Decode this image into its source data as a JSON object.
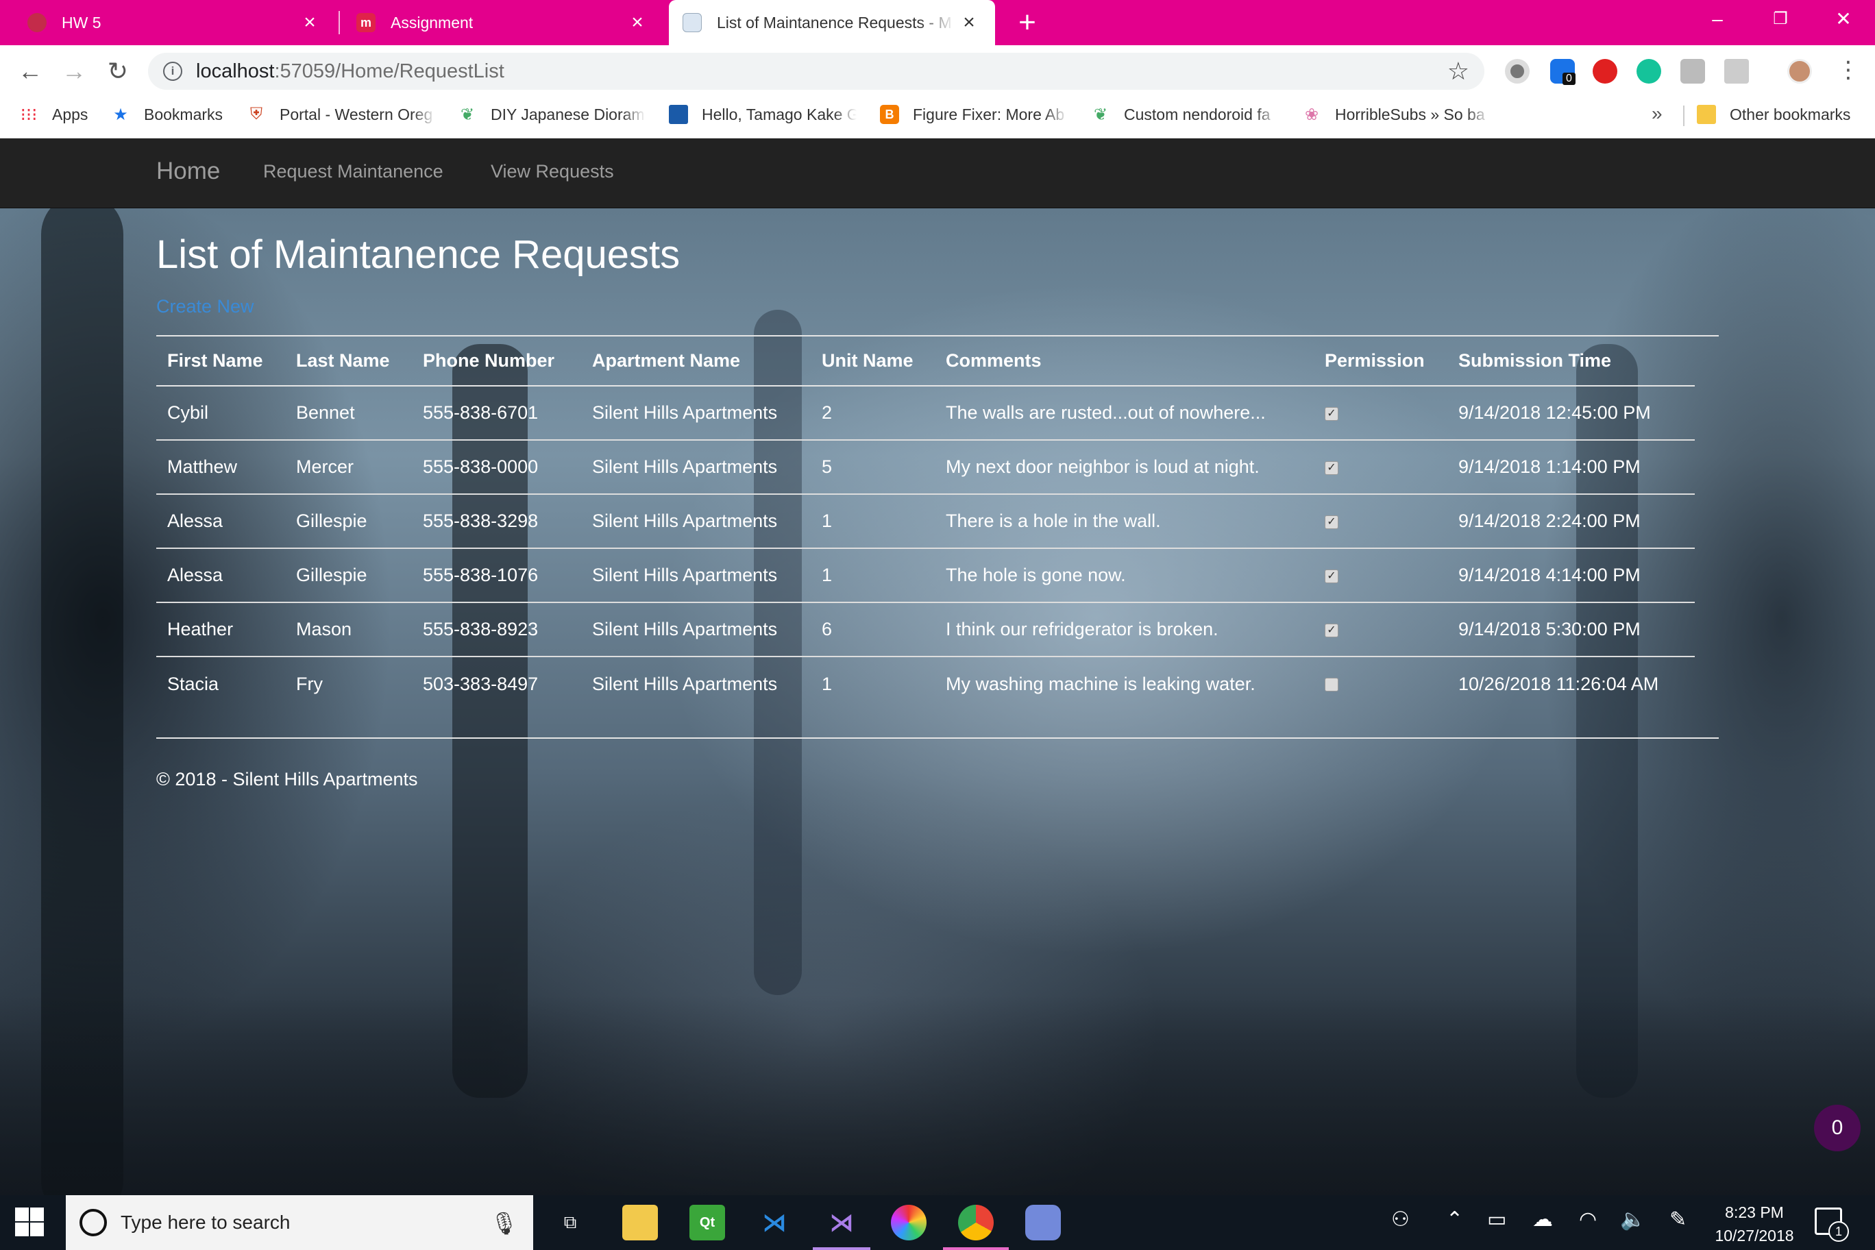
{
  "browser": {
    "tabs": [
      {
        "title": "HW 5",
        "favicon": "red-circle-icon"
      },
      {
        "title": "Assignment",
        "favicon": "m-logo-icon"
      },
      {
        "title": "List of Maintanence Requests - M",
        "favicon": "page-icon",
        "active": true
      }
    ],
    "url_host": "localhost",
    "url_path": ":57059/Home/RequestList",
    "bookmarks": [
      {
        "label": "Apps",
        "icon": "apps-grid-icon"
      },
      {
        "label": "Bookmarks",
        "icon": "star-icon"
      },
      {
        "label": "Portal - Western Oreg",
        "icon": "shield-icon"
      },
      {
        "label": "DIY Japanese Dioram",
        "icon": "leaf-icon"
      },
      {
        "label": "Hello, Tamago Kake G",
        "icon": "folder-icon"
      },
      {
        "label": "Figure Fixer: More Ab",
        "icon": "blogger-icon"
      },
      {
        "label": "Custom nendoroid fa",
        "icon": "leaf-icon"
      },
      {
        "label": "HorribleSubs » So ba",
        "icon": "swirl-icon"
      }
    ],
    "bookmarks_more": "»",
    "other_bookmarks": "Other bookmarks",
    "extension_badge": "0"
  },
  "site": {
    "brand": "Home",
    "nav": [
      "Request Maintanence",
      "View Requests"
    ],
    "page_title": "List of Maintanence Requests",
    "create_new": "Create New",
    "footer": "© 2018 - Silent Hills Apartments",
    "fab_count": "0"
  },
  "table": {
    "headers": [
      "First Name",
      "Last Name",
      "Phone Number",
      "Apartment Name",
      "Unit Name",
      "Comments",
      "Permission",
      "Submission Time"
    ],
    "rows": [
      {
        "first": "Cybil",
        "last": "Bennet",
        "phone": "555-838-6701",
        "apartment": "Silent Hills Apartments",
        "unit": "2",
        "comments": "The walls are rusted...out of nowhere...",
        "permission": true,
        "time": "9/14/2018 12:45:00 PM"
      },
      {
        "first": "Matthew",
        "last": "Mercer",
        "phone": "555-838-0000",
        "apartment": "Silent Hills Apartments",
        "unit": "5",
        "comments": "My next door neighbor is loud at night.",
        "permission": true,
        "time": "9/14/2018 1:14:00 PM"
      },
      {
        "first": "Alessa",
        "last": "Gillespie",
        "phone": "555-838-3298",
        "apartment": "Silent Hills Apartments",
        "unit": "1",
        "comments": "There is a hole in the wall.",
        "permission": true,
        "time": "9/14/2018 2:24:00 PM"
      },
      {
        "first": "Alessa",
        "last": "Gillespie",
        "phone": "555-838-1076",
        "apartment": "Silent Hills Apartments",
        "unit": "1",
        "comments": "The hole is gone now.",
        "permission": true,
        "time": "9/14/2018 4:14:00 PM"
      },
      {
        "first": "Heather",
        "last": "Mason",
        "phone": "555-838-8923",
        "apartment": "Silent Hills Apartments",
        "unit": "6",
        "comments": "I think our refridgerator is broken.",
        "permission": true,
        "time": "9/14/2018 5:30:00 PM"
      },
      {
        "first": "Stacia",
        "last": "Fry",
        "phone": "503-383-8497",
        "apartment": "Silent Hills Apartments",
        "unit": "1",
        "comments": "My washing machine is leaking water.",
        "permission": false,
        "time": "10/26/2018 11:26:04 AM"
      }
    ]
  },
  "taskbar": {
    "search_placeholder": "Type here to search",
    "time": "8:23 PM",
    "date": "10/27/2018",
    "notification_count": "1"
  },
  "colors": {
    "tabstrip": "#e3008c",
    "navbar": "#222222",
    "link": "#3a8ad6",
    "fab": "#4b0b52"
  }
}
